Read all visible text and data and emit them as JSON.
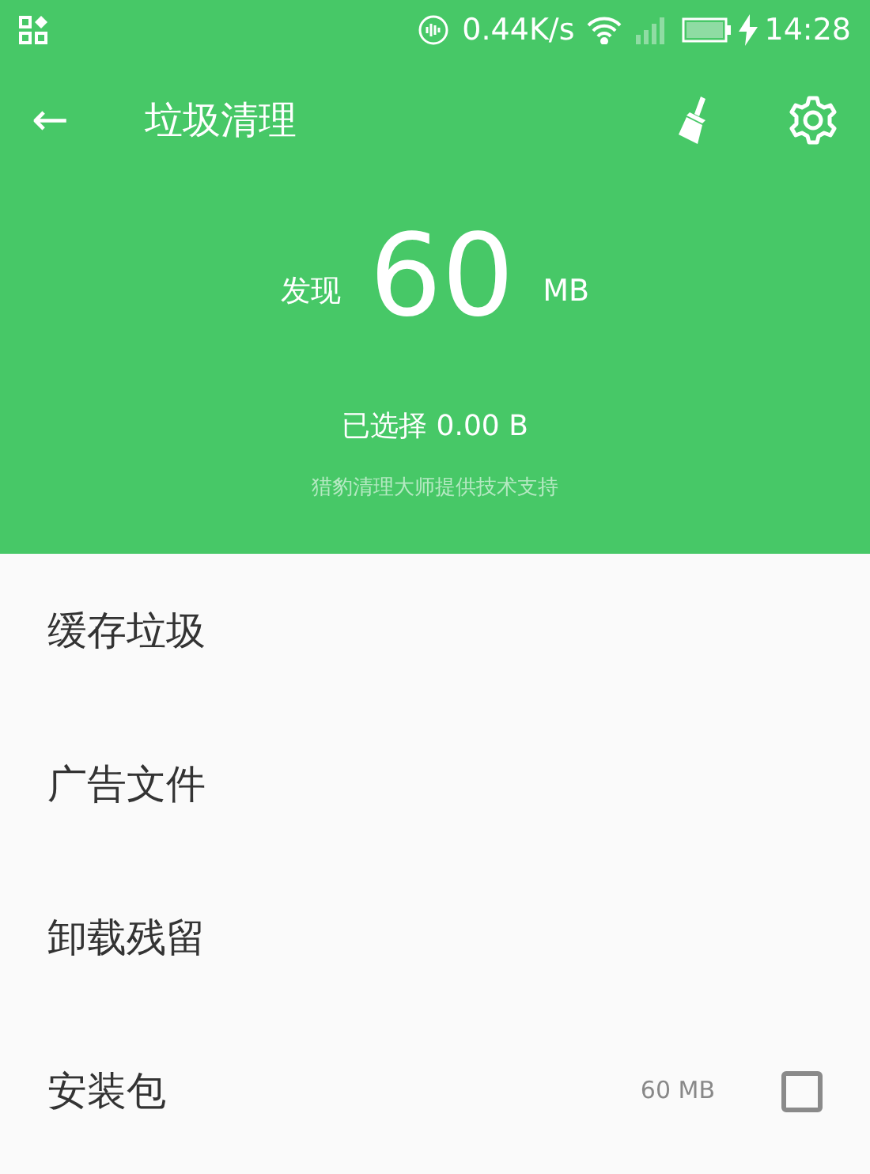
{
  "status_bar": {
    "speed": "0.44K/s",
    "time": "14:28"
  },
  "toolbar": {
    "back": "←",
    "title": "垃圾清理"
  },
  "summary": {
    "prefix": "发现",
    "amount": "60",
    "unit": "MB",
    "selected": "已选择 0.00 B",
    "credit": "猎豹清理大师提供技术支持"
  },
  "items": [
    {
      "kind": "category",
      "label": "缓存垃圾"
    },
    {
      "kind": "category",
      "label": "广告文件"
    },
    {
      "kind": "category",
      "label": "卸载残留"
    },
    {
      "kind": "checkable",
      "label": "安装包",
      "size": "60 MB",
      "checked": false
    }
  ]
}
